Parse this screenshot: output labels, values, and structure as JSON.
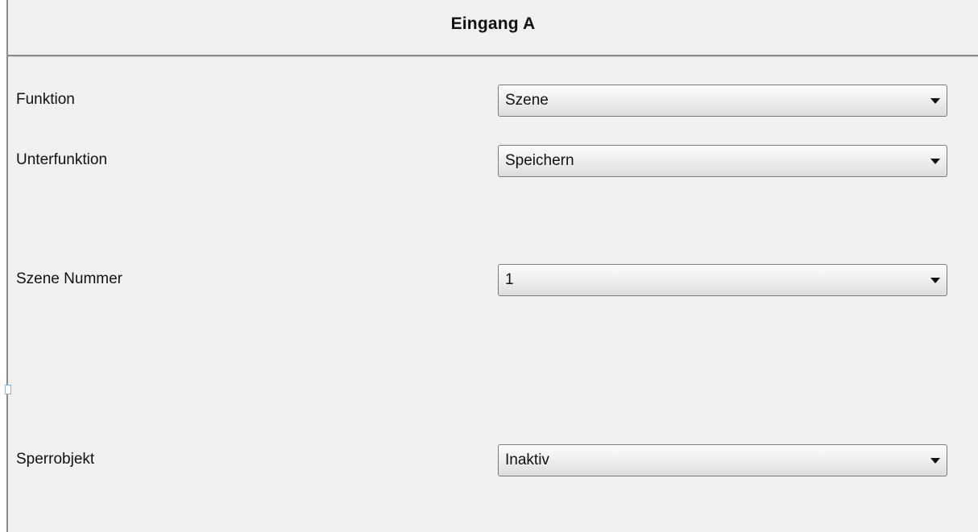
{
  "header": {
    "title": "Eingang A"
  },
  "fields": [
    {
      "label": "Funktion",
      "value": "Szene"
    },
    {
      "label": "Unterfunktion",
      "value": "Speichern"
    },
    {
      "label": "Szene Nummer",
      "value": "1"
    },
    {
      "label": "Sperrobjekt",
      "value": "Inaktiv"
    }
  ],
  "icons": {
    "dropdown": "chevron-down-icon"
  },
  "colors": {
    "panel_background": "#f0f0f0",
    "header_divider": "#8a8a8a",
    "dropdown_border": "#7a7a7a"
  }
}
